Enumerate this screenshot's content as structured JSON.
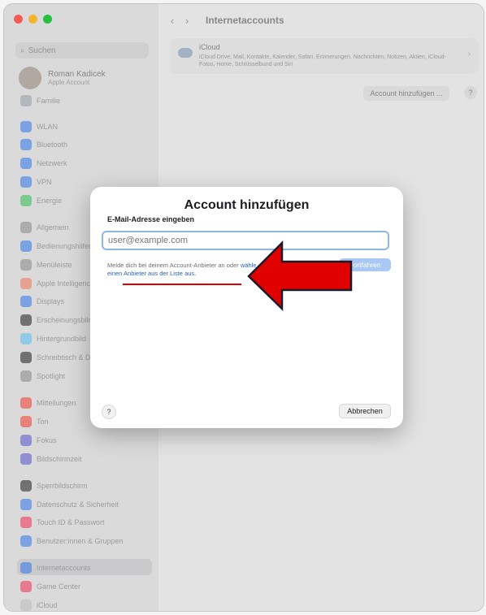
{
  "window": {
    "title": "Internetaccounts",
    "traffic_colors": [
      "#ff5f57",
      "#febc2e",
      "#28c840"
    ]
  },
  "sidebar": {
    "search_placeholder": "Suchen",
    "profile": {
      "name": "Roman Kadicek",
      "sub": "Apple Account"
    },
    "items": [
      {
        "label": "Familie",
        "icon": "family-icon",
        "color": "#9aa4b1"
      },
      {
        "label": "WLAN",
        "icon": "wifi-icon",
        "color": "#2f7cf6"
      },
      {
        "label": "Bluetooth",
        "icon": "bluetooth-icon",
        "color": "#2f7cf6"
      },
      {
        "label": "Netzwerk",
        "icon": "network-icon",
        "color": "#2f7cf6"
      },
      {
        "label": "VPN",
        "icon": "vpn-icon",
        "color": "#2f7cf6"
      },
      {
        "label": "Energie",
        "icon": "battery-icon",
        "color": "#34c759"
      },
      {
        "label": "Allgemein",
        "icon": "gear-icon",
        "color": "#8e8e93"
      },
      {
        "label": "Bedienungshilfen",
        "icon": "accessibility-icon",
        "color": "#2f7cf6"
      },
      {
        "label": "Menüleiste",
        "icon": "menubar-icon",
        "color": "#8e8e93"
      },
      {
        "label": "Apple Intelligence",
        "icon": "intelligence-icon",
        "color": "#ff7a59"
      },
      {
        "label": "Displays",
        "icon": "display-icon",
        "color": "#2f7cf6"
      },
      {
        "label": "Erscheinungsbild",
        "icon": "appearance-icon",
        "color": "#1d1d1f"
      },
      {
        "label": "Hintergrundbild",
        "icon": "wallpaper-icon",
        "color": "#5ac8fa"
      },
      {
        "label": "Schreibtisch & Dock",
        "icon": "dock-icon",
        "color": "#1d1d1f"
      },
      {
        "label": "Spotlight",
        "icon": "spotlight-icon",
        "color": "#8e8e93"
      },
      {
        "label": "Mitteilungen",
        "icon": "notifications-icon",
        "color": "#ff3b30"
      },
      {
        "label": "Ton",
        "icon": "sound-icon",
        "color": "#ff3b30"
      },
      {
        "label": "Fokus",
        "icon": "focus-icon",
        "color": "#5856d6"
      },
      {
        "label": "Bildschirmzeit",
        "icon": "screentime-icon",
        "color": "#5856d6"
      },
      {
        "label": "Sperrbildschirm",
        "icon": "lockscreen-icon",
        "color": "#1d1d1f"
      },
      {
        "label": "Datenschutz & Sicherheit",
        "icon": "privacy-icon",
        "color": "#2f7cf6"
      },
      {
        "label": "Touch ID & Passwort",
        "icon": "fingerprint-icon",
        "color": "#ff2d55"
      },
      {
        "label": "Benutzer:innen & Gruppen",
        "icon": "users-icon",
        "color": "#2f7cf6"
      },
      {
        "label": "Internetaccounts",
        "icon": "at-icon",
        "color": "#2f7cf6"
      },
      {
        "label": "Game Center",
        "icon": "gamecenter-icon",
        "color": "#ff2d55"
      },
      {
        "label": "iCloud",
        "icon": "icloud-icon",
        "color": "#c7c7cc"
      }
    ]
  },
  "main": {
    "icloud": {
      "title": "iCloud",
      "description": "iCloud Drive, Mail, Kontakte, Kalender, Safari, Erinnerungen, Nachrichten, Notizen, Aktien, iCloud-Fotos, Home, Schlüsselbund und Siri"
    },
    "add_account_label": "Account hinzufügen ...",
    "help_label": "?"
  },
  "modal": {
    "title": "Account hinzufügen",
    "field_label": "E-Mail-Adresse eingeben",
    "email_placeholder": "user@example.com",
    "hint_text": "Melde dich bei deinem Account-Anbieter an oder ",
    "hint_link": "wähle einen Anbieter aus der Liste aus.",
    "continue_label": "Fortfahren",
    "help_label": "?",
    "cancel_label": "Abbrechen"
  },
  "annotation": {
    "arrow_color": "#e10000",
    "underline_color": "#d90000"
  }
}
